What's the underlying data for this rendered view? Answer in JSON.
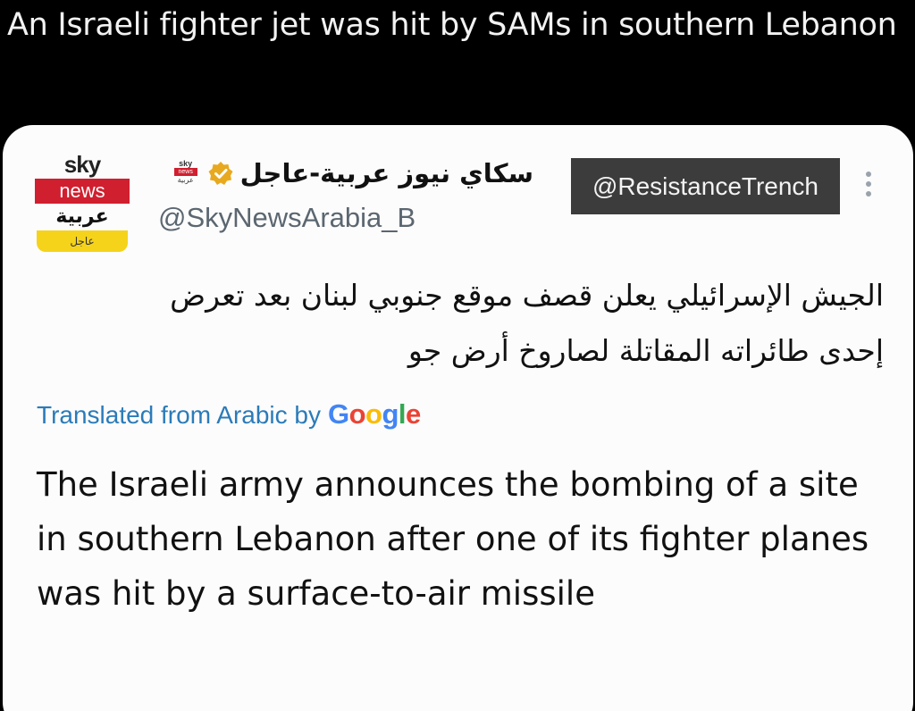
{
  "caption": "An Israeli fighter jet was hit by SAMs in southern Lebanon",
  "tweet": {
    "avatar": {
      "line1": "sky",
      "line2": "news",
      "line3": "عربية",
      "line4": "عاجل"
    },
    "mini_logo": {
      "line1": "sky",
      "line2": "news",
      "line3": "عربية"
    },
    "display_name": "سكاي نيوز عربية-عاجل",
    "handle": "@SkyNewsArabia_B",
    "watermark": "@ResistanceTrench",
    "arabic_body": "الجيش الإسرائيلي يعلن قصف موقع جنوبي لبنان بعد تعرض إحدى طائراته المقاتلة لصاروخ أرض جو",
    "translated_label": "Translated from Arabic by",
    "google_letters": [
      "G",
      "o",
      "o",
      "g",
      "l",
      "e"
    ],
    "translated_body": "The Israeli army announces the bombing of a site in southern Lebanon after one of its fighter planes was hit by a surface-to-air missile"
  },
  "colors": {
    "background": "#000000",
    "card": "#fcfcfc",
    "link_blue": "#2b7bb9",
    "verified_gold": "#e8a91f",
    "sky_red": "#d01f2f",
    "sky_yellow": "#f5d31a"
  },
  "icons": {
    "verified": "verified-badge-icon",
    "more": "more-options-icon"
  }
}
